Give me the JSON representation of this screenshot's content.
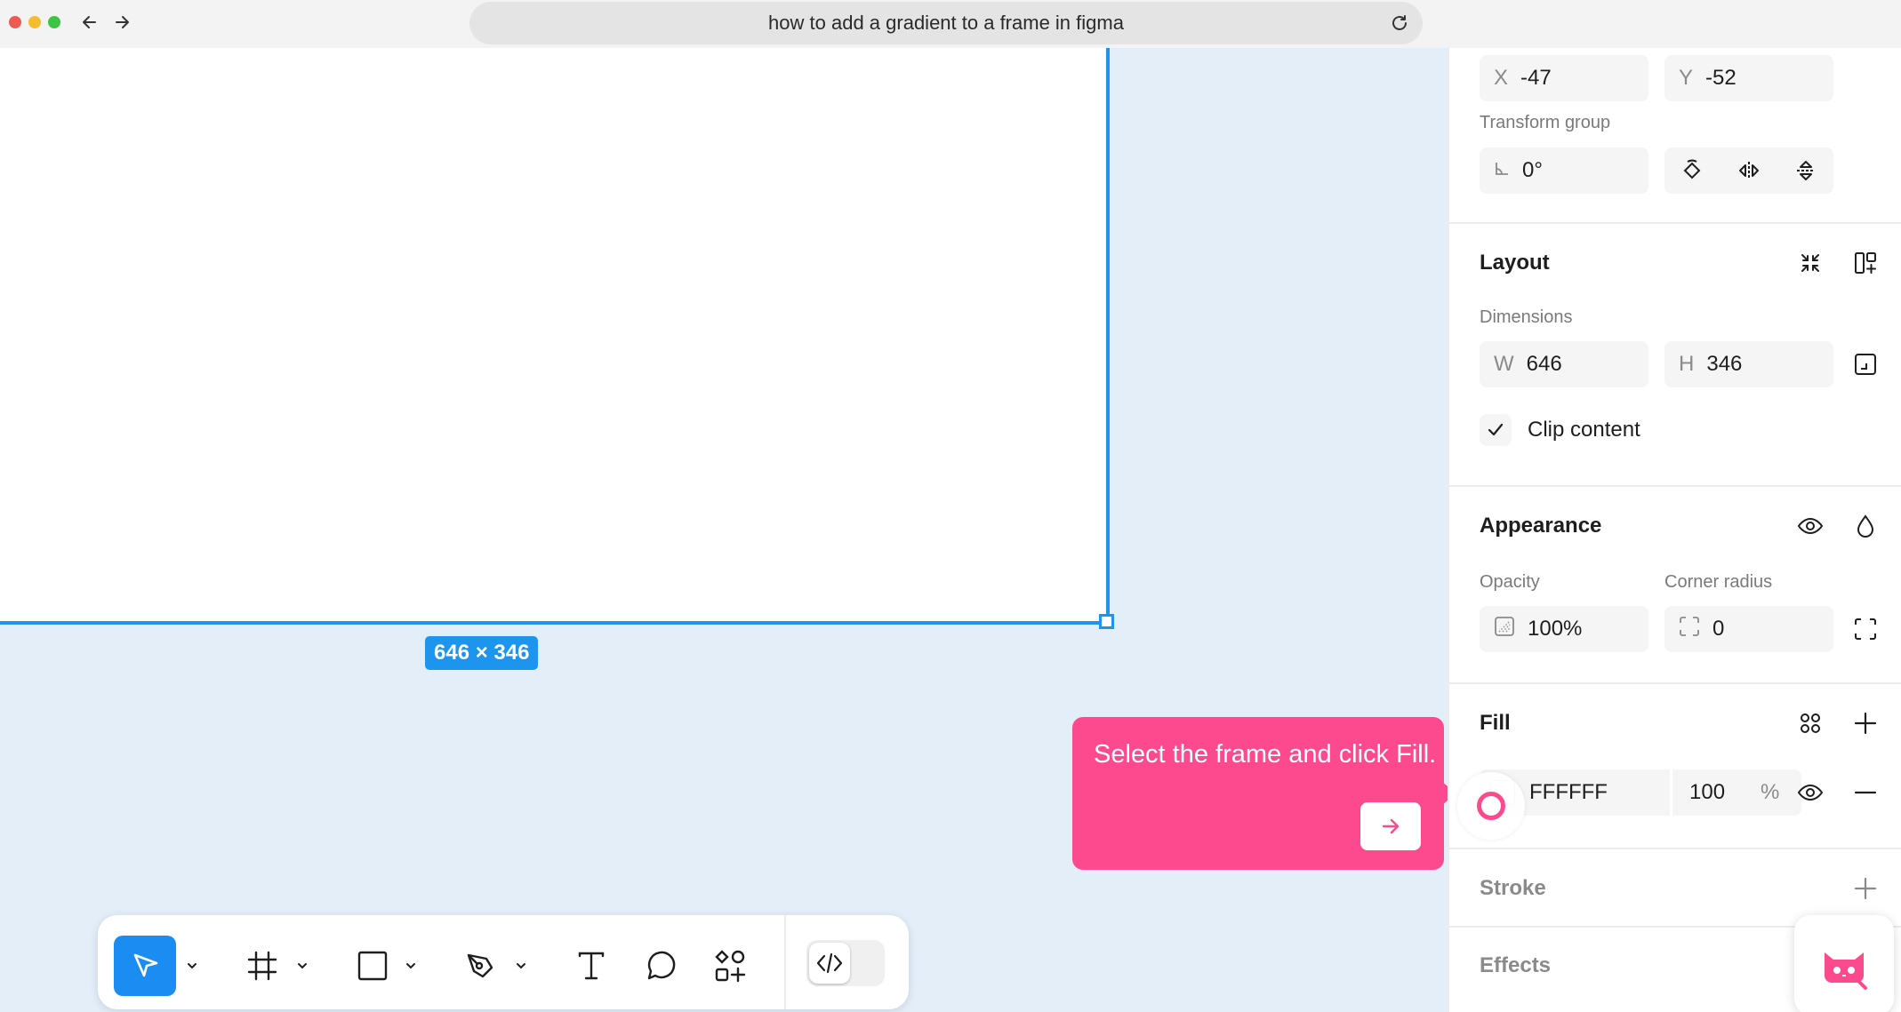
{
  "browser": {
    "url_text": "how to add a gradient to a frame in figma"
  },
  "canvas": {
    "dimension_badge": "646 × 346"
  },
  "tooltip": {
    "text": "Select the frame and click Fill."
  },
  "panel": {
    "position": {
      "x_label": "X",
      "x_value": "-47",
      "y_label": "Y",
      "y_value": "-52"
    },
    "transform": {
      "label": "Transform group",
      "rotation_value": "0°"
    },
    "layout": {
      "title": "Layout",
      "dimensions_label": "Dimensions",
      "w_label": "W",
      "w_value": "646",
      "h_label": "H",
      "h_value": "346",
      "clip_content_label": "Clip content",
      "clip_content_checked": true
    },
    "appearance": {
      "title": "Appearance",
      "opacity_label": "Opacity",
      "opacity_value": "100%",
      "corner_radius_label": "Corner radius",
      "corner_radius_value": "0"
    },
    "fill": {
      "title": "Fill",
      "hex": "FFFFFF",
      "opacity": "100",
      "percent_sign": "%"
    },
    "stroke": {
      "title": "Stroke"
    },
    "effects": {
      "title": "Effects"
    }
  },
  "colors": {
    "accent": "#1d95ef",
    "tooltip": "#fd4a8e",
    "canvas_bg": "#e3eef9"
  }
}
